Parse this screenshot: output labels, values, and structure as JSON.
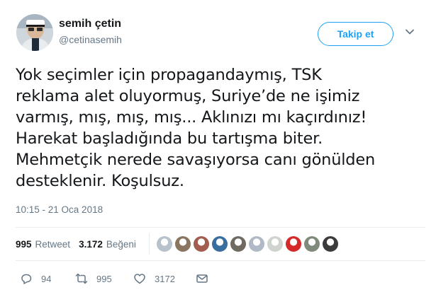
{
  "user": {
    "display_name": "semih çetin",
    "handle": "@cetinasemih",
    "avatar_icon": "profile-photo"
  },
  "follow_button": {
    "label": "Takip et"
  },
  "menu_icon": "chevron-down-icon",
  "tweet": {
    "lines": [
      "Yok seçimler için propagandaymış, TSK",
      "reklama alet oluyormuş, Suriye’de ne işimiz",
      "varmış, mış, mış, mış... Aklınızı mı kaçırdınız!",
      "Harekat başladığında bu tartışma biter.",
      "Mehmetçik nerede savaşıyorsa canı gönülden",
      "desteklenir. Koşulsuz."
    ],
    "timestamp": "10:15 - 21 Oca 2018"
  },
  "stats": {
    "retweets": "995",
    "retweets_label": "Retweet",
    "likes": "3.172",
    "likes_label": "Beğeni"
  },
  "likers": [
    {
      "color": "#b8c2cc"
    },
    {
      "color": "#8a7560"
    },
    {
      "color": "#a35d4f"
    },
    {
      "color": "#3a6e9e"
    },
    {
      "color": "#706b62"
    },
    {
      "color": "#b0b9c5"
    },
    {
      "color": "#cfd4cf"
    },
    {
      "color": "#d42a2a"
    },
    {
      "color": "#808a7a"
    },
    {
      "color": "#3b3b3b"
    }
  ],
  "actions": {
    "reply_count": "94",
    "retweet_count": "995",
    "like_count": "3172"
  },
  "colors": {
    "accent": "#1da1f2",
    "text": "#14171a",
    "muted": "#657786",
    "divider": "#e6ecf0"
  }
}
